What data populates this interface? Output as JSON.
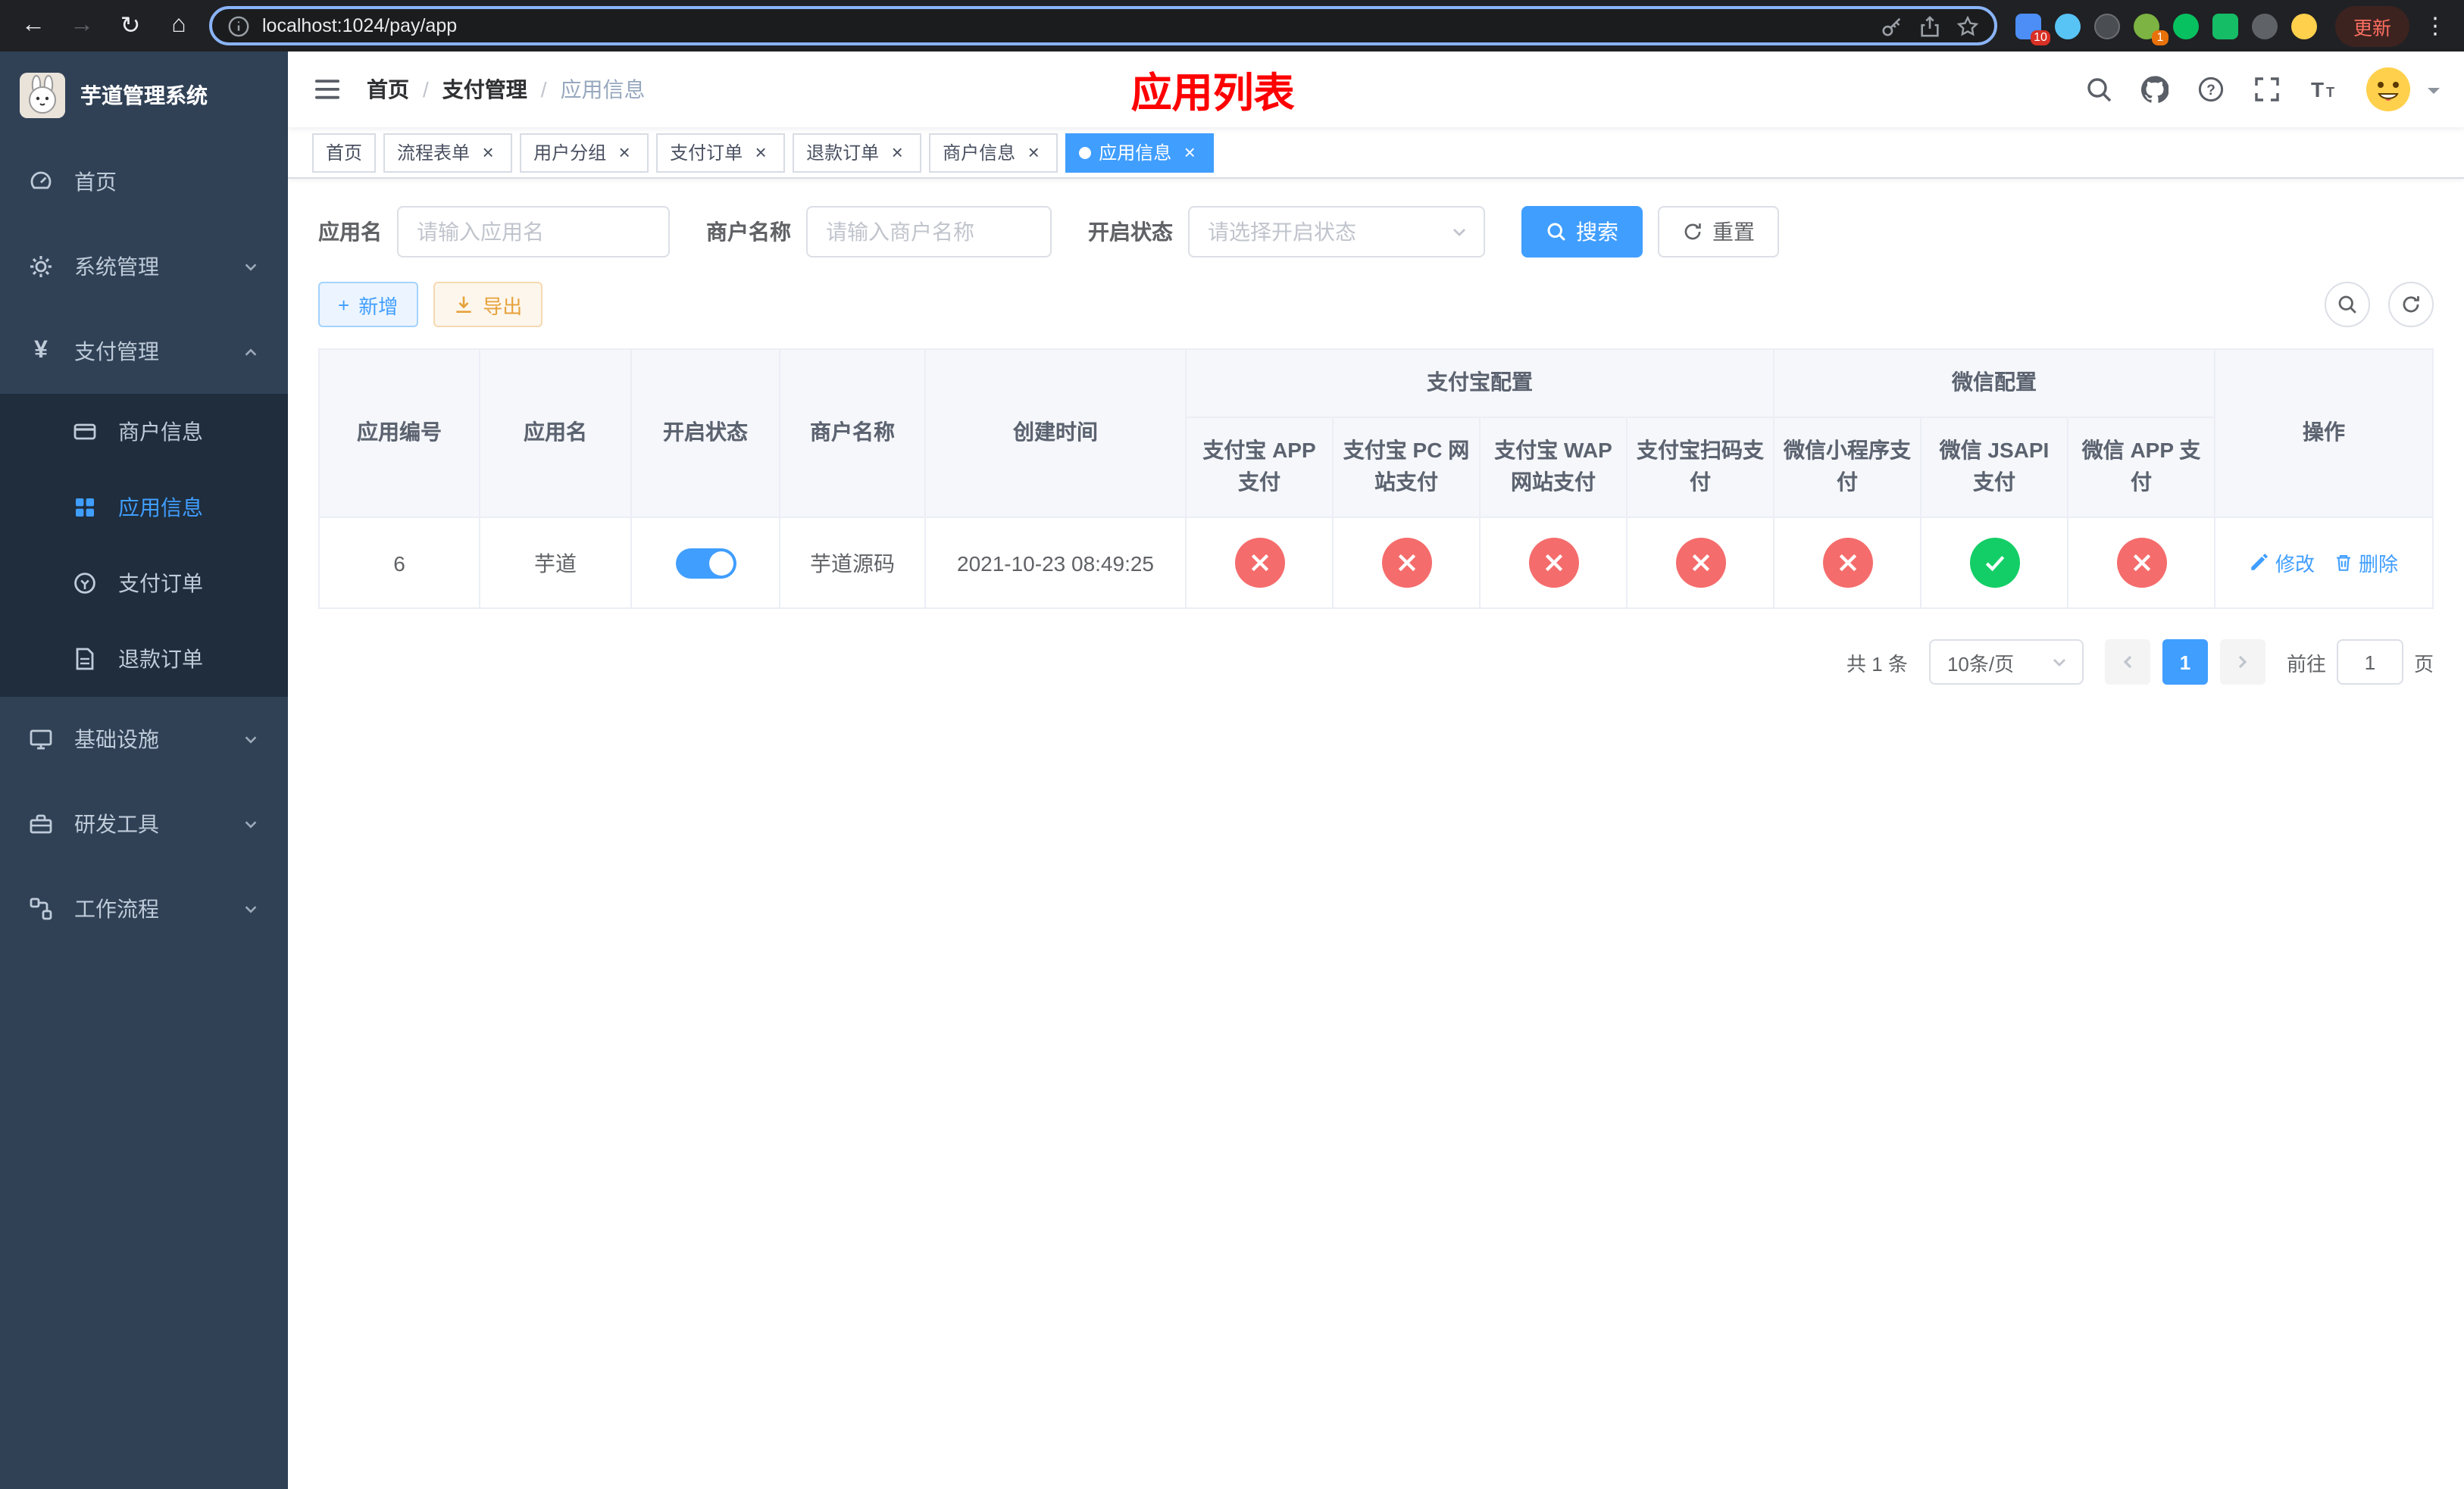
{
  "browser": {
    "url": "localhost:1024/pay/app",
    "update_label": "更新",
    "badges": [
      "10",
      "1"
    ]
  },
  "sidebar": {
    "title": "芋道管理系统",
    "items": [
      {
        "label": "首页"
      },
      {
        "label": "系统管理"
      },
      {
        "label": "支付管理"
      },
      {
        "label": "基础设施"
      },
      {
        "label": "研发工具"
      },
      {
        "label": "工作流程"
      }
    ],
    "payment_children": [
      {
        "label": "商户信息"
      },
      {
        "label": "应用信息"
      },
      {
        "label": "支付订单"
      },
      {
        "label": "退款订单"
      }
    ]
  },
  "navbar": {
    "breadcrumb": [
      "首页",
      "支付管理",
      "应用信息"
    ],
    "page_title": "应用列表"
  },
  "tabs": [
    {
      "label": "首页"
    },
    {
      "label": "流程表单"
    },
    {
      "label": "用户分组"
    },
    {
      "label": "支付订单"
    },
    {
      "label": "退款订单"
    },
    {
      "label": "商户信息"
    },
    {
      "label": "应用信息"
    }
  ],
  "filters": {
    "app_name_label": "应用名",
    "app_name_placeholder": "请输入应用名",
    "merchant_label": "商户名称",
    "merchant_placeholder": "请输入商户名称",
    "status_label": "开启状态",
    "status_placeholder": "请选择开启状态",
    "search_button": "搜索",
    "reset_button": "重置"
  },
  "toolbar": {
    "add_button": "新增",
    "export_button": "导出"
  },
  "table": {
    "columns": {
      "app_id": "应用编号",
      "app_name": "应用名",
      "status": "开启状态",
      "merchant": "商户名称",
      "created": "创建时间",
      "alipay_group": "支付宝配置",
      "wechat_group": "微信配置",
      "actions": "操作"
    },
    "alipay_columns": [
      "支付宝 APP 支付",
      "支付宝 PC 网站支付",
      "支付宝 WAP 网站支付",
      "支付宝扫码支付"
    ],
    "wechat_columns": [
      "微信小程序支付",
      "微信 JSAPI 支付",
      "微信 APP 支付"
    ],
    "rows": [
      {
        "app_id": "6",
        "app_name": "芋道",
        "enabled": true,
        "merchant": "芋道源码",
        "created": "2021-10-23 08:49:25",
        "statuses": [
          false,
          false,
          false,
          false,
          false,
          true,
          false
        ],
        "edit_label": "修改",
        "delete_label": "删除"
      }
    ]
  },
  "pagination": {
    "total": "共 1 条",
    "page_size": "10条/页",
    "page": "1",
    "goto_label": "前往",
    "goto_value": "1",
    "goto_suffix": "页"
  },
  "icons": {
    "back": "←",
    "forward": "→",
    "reload": "↻",
    "home": "⌂",
    "close": "×",
    "check": "✓",
    "more": "⋮"
  },
  "colors": {
    "primary": "#409eff",
    "danger": "#f56c6c",
    "success": "#13ce66",
    "title_red": "#ff0000",
    "sidebar_bg": "#304156",
    "submenu_bg": "#1f2d3d",
    "active_tab": "#409eff"
  }
}
